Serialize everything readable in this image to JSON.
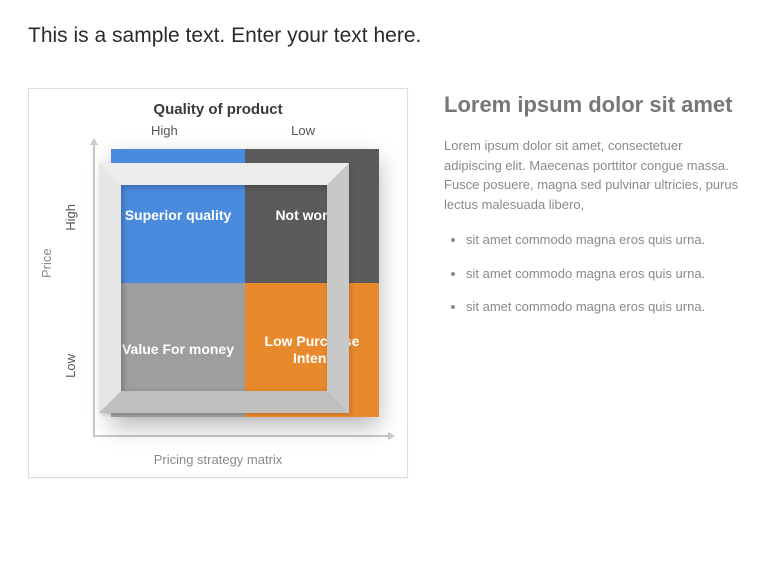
{
  "header": {
    "sample_text": "This is a sample text. Enter your text here."
  },
  "chart_data": {
    "type": "table",
    "title": "Quality of product",
    "xlabel": "Pricing strategy matrix",
    "ylabel": "Price",
    "x_axis_header": "Quality of product",
    "x_categories": [
      "High",
      "Low"
    ],
    "y_categories": [
      "High",
      "Low"
    ],
    "cells": [
      [
        "Superior quality",
        "Not worthy"
      ],
      [
        "Value For money",
        "Low Purchase Intent"
      ]
    ],
    "colors": {
      "q1": "#4b8bdd",
      "q2": "#5b5b5b",
      "q3": "#9e9e9e",
      "q4": "#e88a2c"
    }
  },
  "text_column": {
    "heading": "Lorem ipsum dolor sit amet",
    "paragraph": "Lorem ipsum dolor sit amet, consectetuer adipiscing elit. Maecenas porttitor congue massa. Fusce posuere, magna sed pulvinar ultricies, purus lectus malesuada libero,",
    "bullets": [
      "sit amet commodo magna eros quis urna.",
      "sit amet commodo magna eros quis urna.",
      "sit amet commodo magna eros quis urna."
    ]
  }
}
